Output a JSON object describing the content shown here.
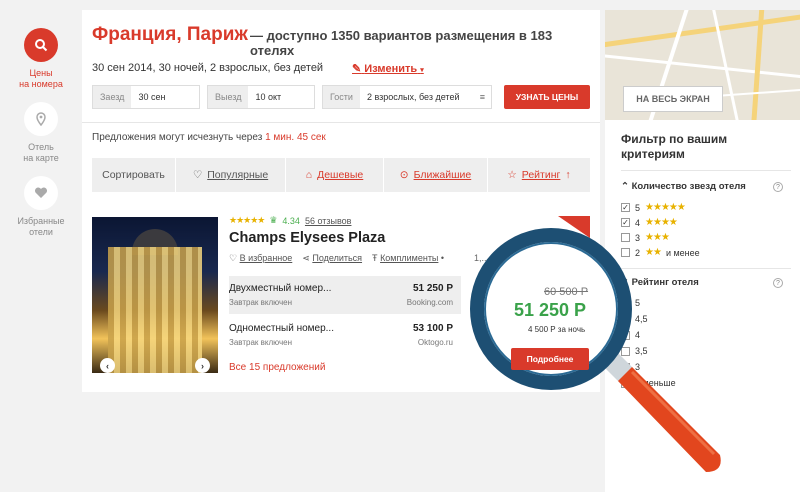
{
  "rail": {
    "items": [
      {
        "label_1": "Цены",
        "label_2": "на номера",
        "icon": "search-icon"
      },
      {
        "label_1": "Отель",
        "label_2": "на карте",
        "icon": "map-pin-icon"
      },
      {
        "label_1": "Избранные",
        "label_2": "отели",
        "icon": "heart-icon"
      }
    ]
  },
  "header": {
    "title": "Франция, Париж",
    "subtitle": "— доступно 1350 вариантов размещения в 183 отелях",
    "trip": "30 сен 2014, 30 ночей, 2 взрослых, без детей",
    "change_label": "Изменить"
  },
  "search": {
    "checkin_label": "Заезд",
    "checkin_value": "30 сен",
    "checkout_label": "Выезд",
    "checkout_value": "10 окт",
    "guests_label": "Гости",
    "guests_value": "2 взрослых, без детей",
    "submit_label": "УЗНАТЬ ЦЕНЫ"
  },
  "offers_notice": {
    "text": "Предложения могут исчезнуть через",
    "timer": "1 мин. 45 сек"
  },
  "sort": {
    "label": "Сортировать",
    "options": [
      {
        "label": "Популярные",
        "icon": "heart-icon"
      },
      {
        "label": "Дешевые",
        "icon": "tag-icon"
      },
      {
        "label": "Ближайшие",
        "icon": "map-pin-icon"
      },
      {
        "label": "Рейтинг",
        "icon": "star-icon",
        "arrow": "↑"
      }
    ]
  },
  "hotel": {
    "stars": "★★★★★",
    "rating": "4.34",
    "reviews": "56 отзывов",
    "name": "Champs Elysees Plaza",
    "favorite": "В избранное",
    "share": "Поделиться",
    "amenities": "Комплименты",
    "distance": "1,... до центра",
    "rooms": [
      {
        "name": "Двухместный номер...",
        "price": "51 250 Р",
        "meal": "Завтрак включен",
        "source": "Booking.com"
      },
      {
        "name": "Одноместный номер...",
        "price": "53 100 Р",
        "meal": "Завтрак включен",
        "source": "Oktogo.ru"
      }
    ],
    "all_offers": "Все 15 предложений",
    "old_price": "60 500 Р",
    "best_price": "51 250 Р",
    "per_night": "4 500 Р за ночь",
    "more_label": "Подробнее"
  },
  "map": {
    "fullscreen_label": "НА ВЕСЬ ЭКРАН"
  },
  "filters": {
    "title": "Фильтр по вашим критериям",
    "stars_section": "Количество звезд отеля",
    "star_rows": [
      {
        "num": "5",
        "stars": "★★★★★",
        "checked": true,
        "suffix": ""
      },
      {
        "num": "4",
        "stars": "★★★★",
        "checked": true,
        "suffix": ""
      },
      {
        "num": "3",
        "stars": "★★★",
        "checked": false,
        "suffix": ""
      },
      {
        "num": "2",
        "stars": "★★",
        "checked": false,
        "suffix": "и менее"
      }
    ],
    "rating_section": "Рейтинг отеля",
    "rating_rows": [
      "5",
      "4,5",
      "4",
      "3,5",
      "3",
      "и меньше"
    ]
  },
  "colors": {
    "accent": "#d93a2b",
    "price_green": "#3aa24a",
    "lens_ring": "#1d4f73",
    "handle": "#e2461e"
  }
}
